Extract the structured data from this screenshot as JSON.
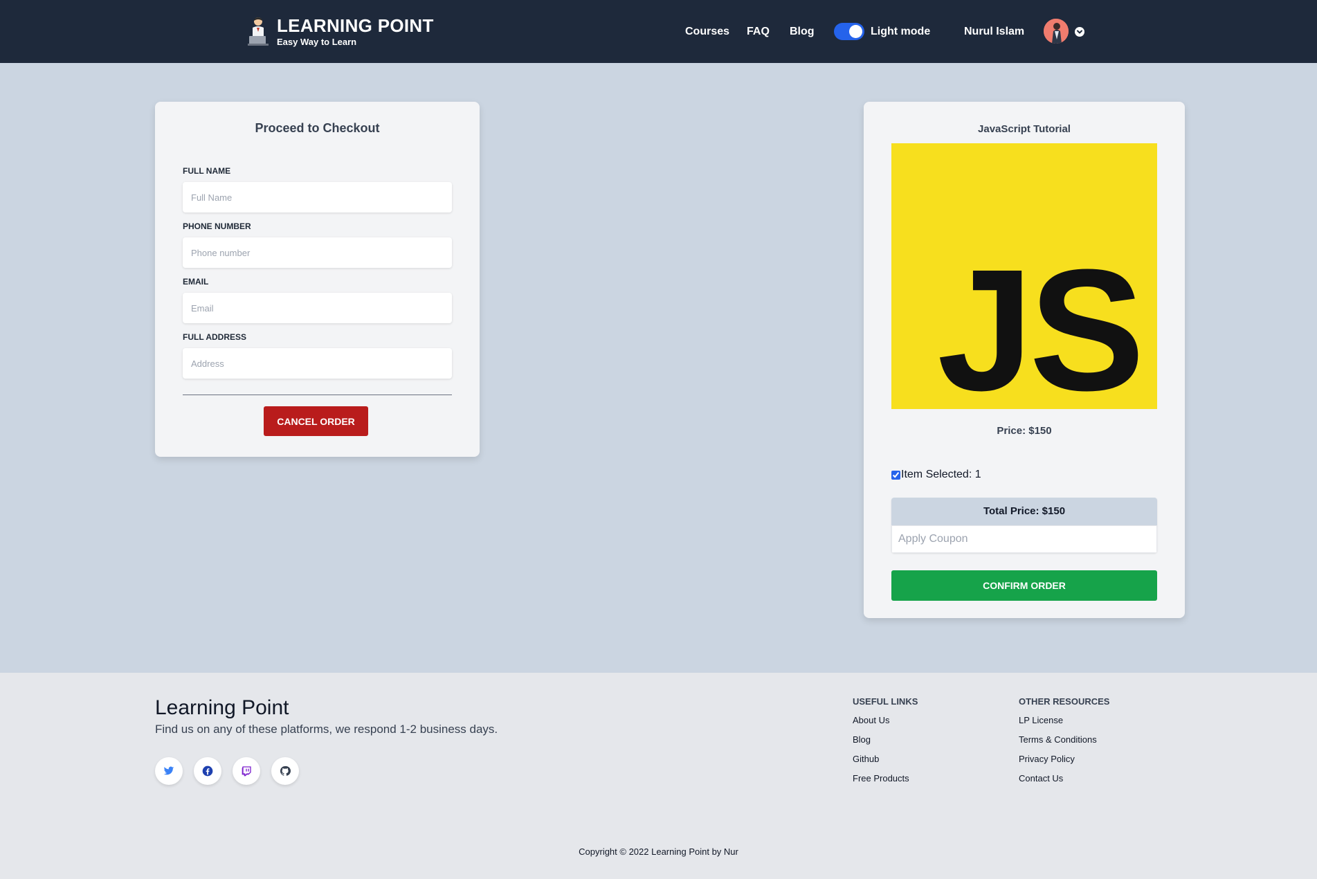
{
  "nav": {
    "brand_title": "LEARNING POINT",
    "brand_tagline": "Easy Way to Learn",
    "links": [
      "Courses",
      "FAQ",
      "Blog"
    ],
    "mode_label": "Light mode",
    "user_name": "Nurul Islam"
  },
  "checkout": {
    "heading": "Proceed to Checkout",
    "fields": [
      {
        "label": "FULL NAME",
        "placeholder": "Full Name"
      },
      {
        "label": "PHONE NUMBER",
        "placeholder": "Phone number"
      },
      {
        "label": "EMAIL",
        "placeholder": "Email"
      },
      {
        "label": "FULL ADDRESS",
        "placeholder": "Address"
      }
    ],
    "cancel_label": "CANCEL ORDER"
  },
  "product": {
    "title": "JavaScript Tutorial",
    "image_text": "JS",
    "price": "Price: $150",
    "selected_text": "Item Selected: 1",
    "total": "Total Price: $150",
    "coupon_placeholder": "Apply Coupon",
    "confirm_label": "CONFIRM ORDER"
  },
  "footer": {
    "title": "Learning Point",
    "subtitle": "Find us on any of these platforms, we respond 1-2 business days.",
    "social": [
      "twitter-icon",
      "facebook-icon",
      "twitch-icon",
      "github-icon"
    ],
    "useful_links": {
      "heading": "USEFUL LINKS",
      "items": [
        "About Us",
        "Blog",
        "Github",
        "Free Products"
      ]
    },
    "other_resources": {
      "heading": "OTHER RESOURCES",
      "items": [
        "LP License",
        "Terms & Conditions",
        "Privacy Policy",
        "Contact Us"
      ]
    },
    "copyright": "Copyright © 2022 Learning Point by Nur"
  },
  "colors": {
    "navbar": "#1e293b",
    "page_bg": "#cbd5e1",
    "cancel": "#b91c1c",
    "confirm": "#16a34a",
    "js_yellow": "#f7df1e",
    "toggle": "#2563eb"
  }
}
